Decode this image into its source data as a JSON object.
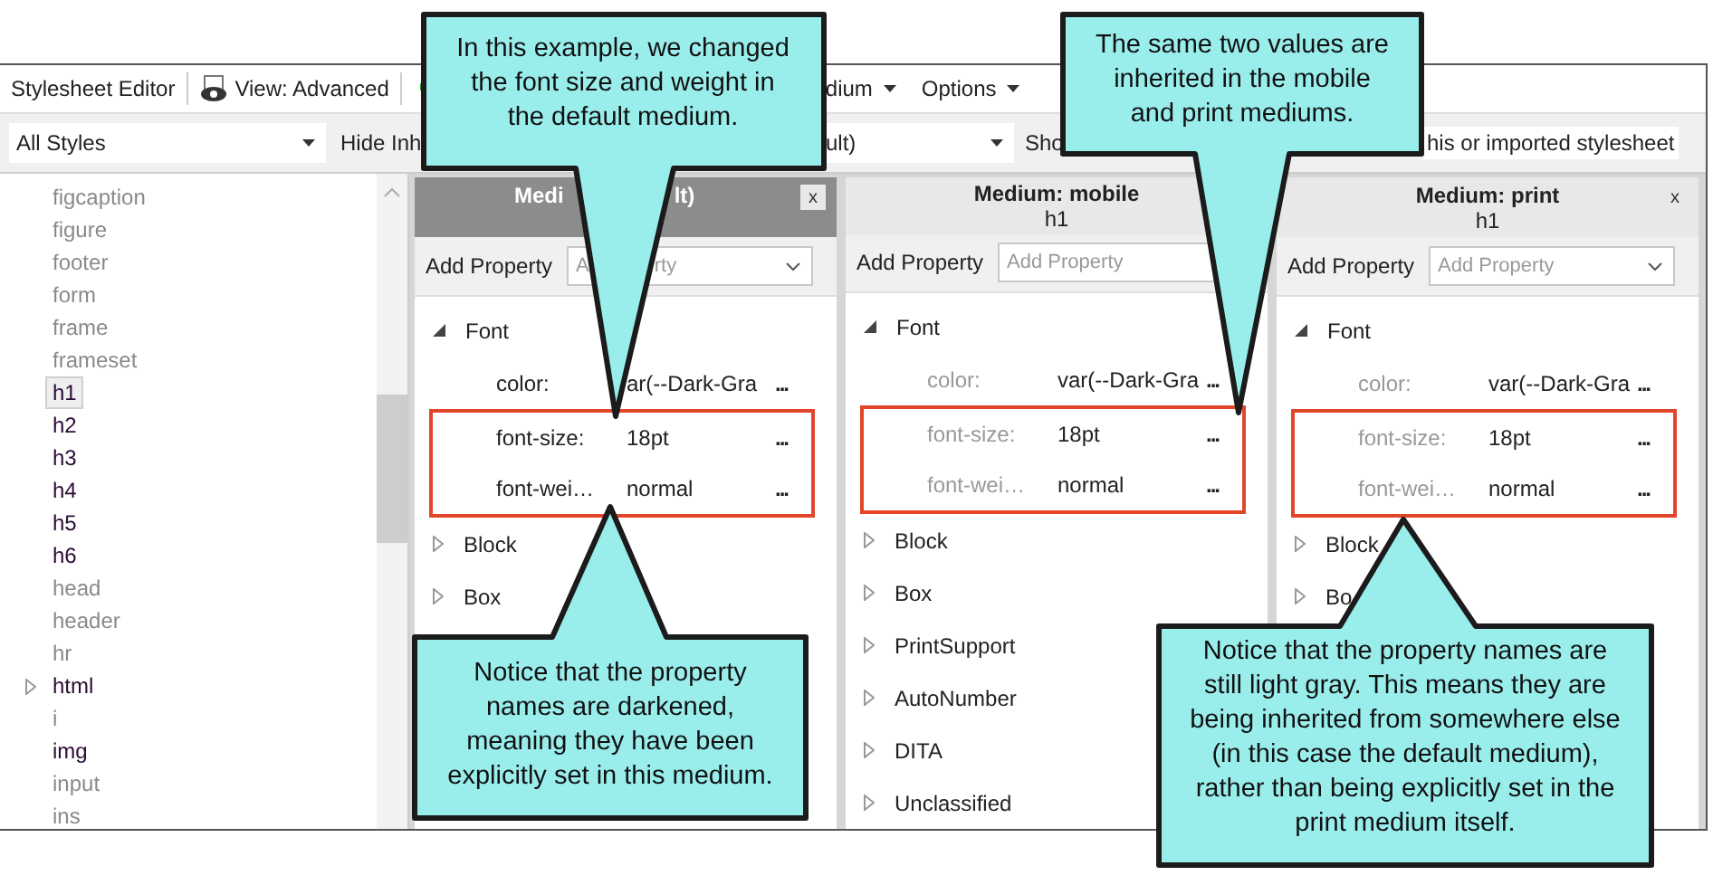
{
  "toolbar": [
    {
      "kind": "title",
      "text": "Stylesheet Editor"
    },
    {
      "kind": "view",
      "text": "View: Advanced"
    },
    {
      "kind": "add"
    },
    {
      "kind": "menu",
      "text": "dium"
    },
    {
      "kind": "menu",
      "text": "Options"
    }
  ],
  "filters": [
    {
      "kind": "dropdown",
      "text": "All Styles"
    },
    {
      "kind": "label",
      "text": "Hide Inh"
    },
    {
      "kind": "dropdown",
      "text": "ult)"
    },
    {
      "kind": "label",
      "text": "Sho"
    },
    {
      "kind": "label",
      "text": "his or imported stylesheet"
    }
  ],
  "styles": [
    {
      "name": "figcaption",
      "explicit": false,
      "selected": false,
      "collapsed": false
    },
    {
      "name": "figure",
      "explicit": false,
      "selected": false,
      "collapsed": false
    },
    {
      "name": "footer",
      "explicit": false,
      "selected": false,
      "collapsed": false
    },
    {
      "name": "form",
      "explicit": false,
      "selected": false,
      "collapsed": false
    },
    {
      "name": "frame",
      "explicit": false,
      "selected": false,
      "collapsed": false
    },
    {
      "name": "frameset",
      "explicit": false,
      "selected": false,
      "collapsed": false
    },
    {
      "name": "h1",
      "explicit": true,
      "selected": true,
      "collapsed": false
    },
    {
      "name": "h2",
      "explicit": true,
      "selected": false,
      "collapsed": false
    },
    {
      "name": "h3",
      "explicit": true,
      "selected": false,
      "collapsed": false
    },
    {
      "name": "h4",
      "explicit": true,
      "selected": false,
      "collapsed": false
    },
    {
      "name": "h5",
      "explicit": true,
      "selected": false,
      "collapsed": false
    },
    {
      "name": "h6",
      "explicit": true,
      "selected": false,
      "collapsed": false
    },
    {
      "name": "head",
      "explicit": false,
      "selected": false,
      "collapsed": false
    },
    {
      "name": "header",
      "explicit": false,
      "selected": false,
      "collapsed": false
    },
    {
      "name": "hr",
      "explicit": false,
      "selected": false,
      "collapsed": false
    },
    {
      "name": "html",
      "explicit": true,
      "selected": false,
      "collapsed": true
    },
    {
      "name": "i",
      "explicit": false,
      "selected": false,
      "collapsed": false
    },
    {
      "name": "img",
      "explicit": true,
      "selected": false,
      "collapsed": false
    },
    {
      "name": "input",
      "explicit": false,
      "selected": false,
      "collapsed": false
    },
    {
      "name": "ins",
      "explicit": false,
      "selected": false,
      "collapsed": false
    }
  ],
  "panels": [
    {
      "title": [
        "Medi",
        "lt)"
      ],
      "selected": true,
      "close_label": "x",
      "add_label": "Add Property",
      "placeholder": [
        "A",
        "rty"
      ],
      "groups": [
        {
          "name": "Font",
          "expanded": true,
          "properties": [
            {
              "name": "color:",
              "value": "ar(--Dark-Gra",
              "explicit": true,
              "highlighted": false,
              "more": "..."
            },
            {
              "name": "font-size:",
              "value": "18pt",
              "explicit": true,
              "highlighted": true,
              "more": "..."
            },
            {
              "name": "font-wei…",
              "value": "normal",
              "explicit": true,
              "highlighted": true,
              "more": "..."
            }
          ]
        },
        {
          "name": "Block",
          "expanded": false
        },
        {
          "name": "Box",
          "expanded": false
        }
      ]
    },
    {
      "title": [
        "Medium: mobile"
      ],
      "subtitle": "h1",
      "selected": false,
      "add_label": "Add Property",
      "placeholder": [
        "Add Property"
      ],
      "groups": [
        {
          "name": "Font",
          "expanded": true,
          "properties": [
            {
              "name": "color:",
              "value": "var(--Dark-Gra",
              "explicit": false,
              "highlighted": false,
              "more": "..."
            },
            {
              "name": "font-size:",
              "value": "18pt",
              "explicit": false,
              "highlighted": true,
              "more": "..."
            },
            {
              "name": "font-wei…",
              "value": "normal",
              "explicit": false,
              "highlighted": true,
              "more": "..."
            }
          ]
        },
        {
          "name": "Block",
          "expanded": false
        },
        {
          "name": "Box",
          "expanded": false
        },
        {
          "name": "PrintSupport",
          "expanded": false
        },
        {
          "name": "AutoNumber",
          "expanded": false
        },
        {
          "name": "DITA",
          "expanded": false
        },
        {
          "name": "Unclassified",
          "expanded": false
        }
      ]
    },
    {
      "title": [
        "Medium: print"
      ],
      "subtitle": "h1",
      "selected": false,
      "close_label": "x",
      "add_label": "Add Property",
      "placeholder": [
        "Add Property"
      ],
      "groups": [
        {
          "name": "Font",
          "expanded": true,
          "properties": [
            {
              "name": "color:",
              "value": "var(--Dark-Gra",
              "explicit": false,
              "highlighted": false,
              "more": "..."
            },
            {
              "name": "font-size:",
              "value": "18pt",
              "explicit": false,
              "highlighted": true,
              "more": "..."
            },
            {
              "name": "font-wei…",
              "value": "normal",
              "explicit": false,
              "highlighted": true,
              "more": "..."
            }
          ]
        },
        {
          "name": "Block",
          "expanded": false
        },
        {
          "name": "Bo",
          "expanded": false
        }
      ]
    }
  ],
  "callouts": [
    {
      "text": "In this example, we changed the font size and weight in the default medium."
    },
    {
      "text": "The same two values are inherited in the mobile and print mediums."
    },
    {
      "text": "Notice that the property names are darkened, meaning they have been explicitly set in this medium."
    },
    {
      "text": "Notice that the property names are still light gray. This means they are being inherited from somewhere else (in this case the default medium), rather than being explicitly set in the print medium itself."
    }
  ]
}
